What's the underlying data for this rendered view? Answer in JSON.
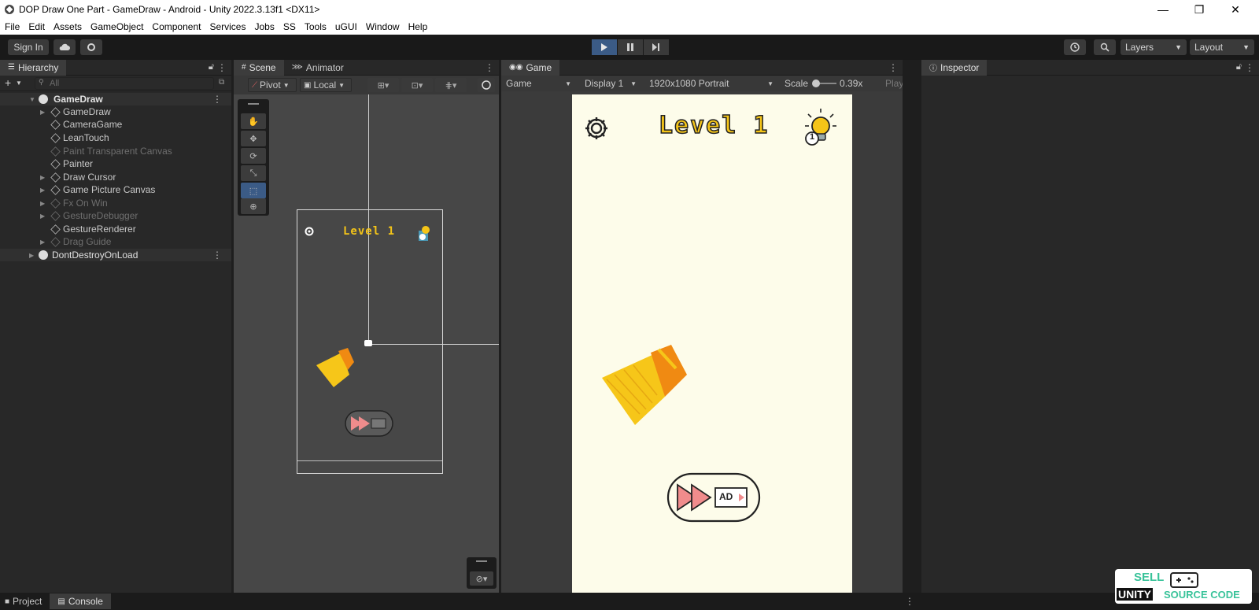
{
  "window": {
    "title": "DOP Draw One Part - GameDraw - Android - Unity 2022.3.13f1 <DX11>",
    "controls": [
      "—",
      "❐",
      "✕"
    ]
  },
  "menu": [
    "File",
    "Edit",
    "Assets",
    "GameObject",
    "Component",
    "Services",
    "Jobs",
    "SS",
    "Tools",
    "uGUI",
    "Window",
    "Help"
  ],
  "toolbar": {
    "sign_in": "Sign In",
    "layers": "Layers",
    "layout": "Layout"
  },
  "hierarchy": {
    "tab": "Hierarchy",
    "search_placeholder": "All",
    "items": [
      {
        "label": "GameDraw",
        "level": 0,
        "dim": false
      },
      {
        "label": "GameDraw",
        "level": 1,
        "dim": false
      },
      {
        "label": "CameraGame",
        "level": 1,
        "dim": false
      },
      {
        "label": "LeanTouch",
        "level": 1,
        "dim": false
      },
      {
        "label": "Paint Transparent Canvas",
        "level": 1,
        "dim": true
      },
      {
        "label": "Painter",
        "level": 1,
        "dim": false
      },
      {
        "label": "Draw Cursor",
        "level": 1,
        "dim": false
      },
      {
        "label": "Game Picture Canvas",
        "level": 1,
        "dim": false
      },
      {
        "label": "Fx On Win",
        "level": 1,
        "dim": true
      },
      {
        "label": "GestureDebugger",
        "level": 1,
        "dim": true
      },
      {
        "label": "GestureRenderer",
        "level": 1,
        "dim": false
      },
      {
        "label": "Drag Guide",
        "level": 1,
        "dim": true
      },
      {
        "label": "DontDestroyOnLoad",
        "level": 0,
        "dim": false
      }
    ]
  },
  "scene": {
    "tabs": [
      "Scene",
      "Animator"
    ],
    "pivot": "Pivot",
    "local": "Local",
    "level_text": "Level 1"
  },
  "game": {
    "tab": "Game",
    "mode": "Game",
    "display": "Display 1",
    "resolution": "1920x1080 Portrait",
    "scale_label": "Scale",
    "scale_value": "0.39x",
    "play_label": "Play Ur",
    "level_text": "Level 1",
    "hint_count": "1",
    "ad_label": "AD"
  },
  "inspector": {
    "tab": "Inspector"
  },
  "bottom_tabs": [
    "Project",
    "Console"
  ],
  "watermark": {
    "line1": "SELL",
    "line2a": "UNITY",
    "line2b": "SOURCE CODE"
  },
  "colors": {
    "accent": "#3b5b86",
    "broom_yellow": "#f6c619",
    "broom_orange": "#f08a12",
    "skip_pink": "#f08c8c",
    "game_bg": "#fdfcea"
  }
}
